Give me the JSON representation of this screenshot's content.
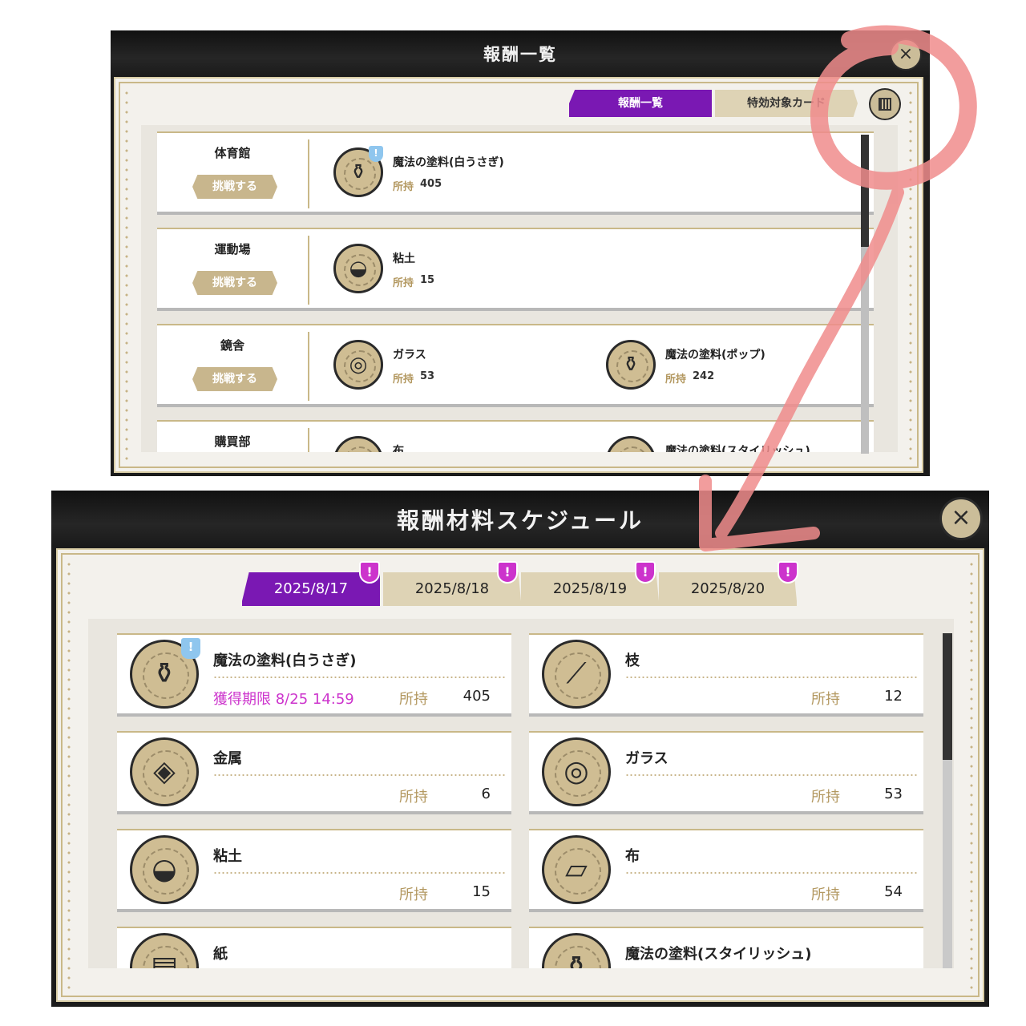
{
  "top_window": {
    "title": "報酬一覧",
    "close_glyph": "×",
    "tabs": [
      {
        "label": "報酬一覧",
        "active": true
      },
      {
        "label": "特効対象カード",
        "active": false
      }
    ],
    "calendar_icon": "calendar-icon",
    "rows": [
      {
        "place": "体育館",
        "challenge": "挑戦する",
        "rewards": [
          {
            "name": "魔法の塗料(白うさぎ)",
            "own_label": "所持",
            "count": "405",
            "icon": "paint-jar-icon",
            "badge": "!"
          }
        ]
      },
      {
        "place": "運動場",
        "challenge": "挑戦する",
        "rewards": [
          {
            "name": "粘土",
            "own_label": "所持",
            "count": "15",
            "icon": "clay-icon"
          }
        ]
      },
      {
        "place": "鏡舎",
        "challenge": "挑戦する",
        "rewards": [
          {
            "name": "ガラス",
            "own_label": "所持",
            "count": "53",
            "icon": "glass-orb-icon"
          },
          {
            "name": "魔法の塗料(ポップ)",
            "own_label": "所持",
            "count": "242",
            "icon": "paint-jar-icon"
          }
        ]
      },
      {
        "place": "購買部",
        "challenge": "",
        "rewards": [
          {
            "name": "布",
            "icon": "cloth-icon"
          },
          {
            "name": "魔法の塗料(スタイリッシュ)",
            "icon": "paint-jar-icon"
          }
        ]
      }
    ]
  },
  "bottom_window": {
    "title": "報酬材料スケジュール",
    "close_glyph": "×",
    "date_tabs": [
      {
        "label": "2025/8/17",
        "active": true,
        "badge": "!"
      },
      {
        "label": "2025/8/18",
        "active": false,
        "badge": "!"
      },
      {
        "label": "2025/8/19",
        "active": false,
        "badge": "!"
      },
      {
        "label": "2025/8/20",
        "active": false,
        "badge": "!"
      }
    ],
    "own_label": "所持",
    "materials": [
      {
        "name": "魔法の塗料(白うさぎ)",
        "expire": "獲得期限 8/25 14:59",
        "count": "405",
        "icon": "paint-jar-icon",
        "badge": "!"
      },
      {
        "name": "枝",
        "expire": "",
        "count": "12",
        "icon": "branch-icon"
      },
      {
        "name": "金属",
        "expire": "",
        "count": "6",
        "icon": "metal-ingot-icon"
      },
      {
        "name": "ガラス",
        "expire": "",
        "count": "53",
        "icon": "glass-orb-icon"
      },
      {
        "name": "粘土",
        "expire": "",
        "count": "15",
        "icon": "clay-icon"
      },
      {
        "name": "布",
        "expire": "",
        "count": "54",
        "icon": "cloth-icon"
      },
      {
        "name": "紙",
        "expire": "",
        "count": "",
        "icon": "paper-icon"
      },
      {
        "name": "魔法の塗料(スタイリッシュ)",
        "expire": "",
        "count": "",
        "icon": "paint-jar-icon"
      }
    ]
  },
  "annotation": {
    "color": "#f08c8c",
    "description_icon": "highlight-arrow"
  }
}
